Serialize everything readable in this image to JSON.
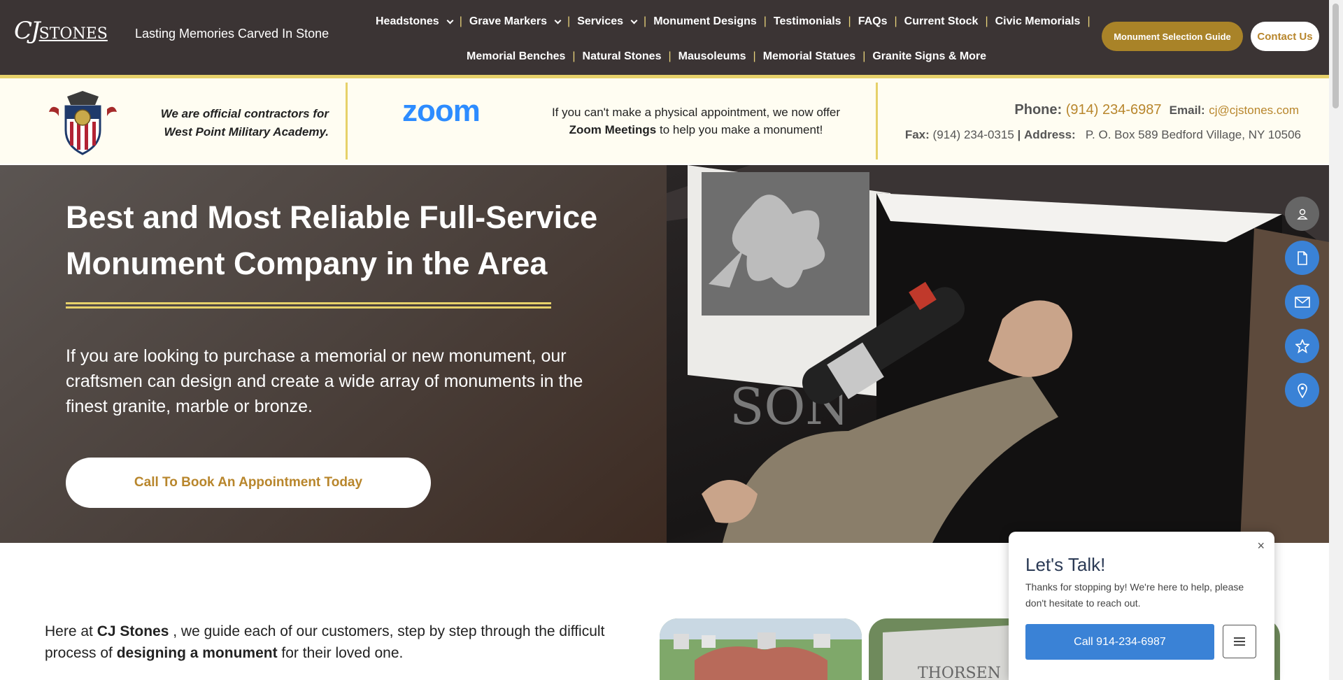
{
  "header": {
    "logo_text_script": "CJ",
    "logo_text_stones": "STONES",
    "tagline": "Lasting Memories Carved In Stone",
    "nav_row1": [
      {
        "label": "Headstones",
        "dropdown": true
      },
      {
        "label": "Grave Markers",
        "dropdown": true
      },
      {
        "label": "Services",
        "dropdown": true
      },
      {
        "label": "Monument Designs",
        "dropdown": false
      },
      {
        "label": "Testimonials",
        "dropdown": false
      },
      {
        "label": "FAQs",
        "dropdown": false
      },
      {
        "label": "Current Stock",
        "dropdown": false
      },
      {
        "label": "Civic Memorials",
        "dropdown": false
      }
    ],
    "nav_row2": [
      {
        "label": "Memorial Benches"
      },
      {
        "label": "Natural Stones"
      },
      {
        "label": "Mausoleums"
      },
      {
        "label": "Memorial Statues"
      },
      {
        "label": "Granite Signs & More"
      }
    ],
    "separator": "|",
    "guide_button": "Monument Selection Guide",
    "contact_button": "Contact Us"
  },
  "info_bar": {
    "contractor_line1": "We are official contractors for",
    "contractor_line2": "West Point Military Academy.",
    "zoom_logo": "zoom",
    "zoom_text_1": "If you can't make a physical appointment, we now offer",
    "zoom_text_bold": "Zoom Meetings",
    "zoom_text_2": "to help you make a monument!",
    "phone_label": "Phone:",
    "phone": "(914) 234-6987",
    "email_label": "Email:",
    "email": "cj@cjstones.com",
    "fax_label": "Fax:",
    "fax": "(914) 234-0315",
    "address_sep": "|",
    "address_label": "Address:",
    "address": "P. O. Box 589 Bedford Village, NY 10506"
  },
  "hero": {
    "title": "Best and Most Reliable Full-Service Monument Company in the Area",
    "text": "If you are looking to purchase a memorial or new monument, our craftsmen can design and create a wide array of monuments in the finest granite, marble or bronze.",
    "button": "Call To Book An Appointment Today"
  },
  "side_buttons": [
    "user-icon",
    "document-icon",
    "mail-icon",
    "star-icon",
    "location-pin-icon"
  ],
  "lower": {
    "text_1": "Here at",
    "brand": "CJ Stones",
    "text_2": ", we guide each of our customers, step by step through the difficult process of",
    "bold_2": "designing a monument",
    "text_3": "for their loved one."
  },
  "chat": {
    "close": "×",
    "title": "Let's Talk!",
    "text": "Thanks for stopping by! We're here to help, please don't hesitate to reach out.",
    "call_button": "Call 914-234-6987"
  },
  "colors": {
    "header_bg": "#3b3434",
    "accent_gold": "#e6d16a",
    "button_gold": "#a98328",
    "text_gold": "#b8862c",
    "zoom_blue": "#2d8cff",
    "chat_blue": "#3a82d6"
  }
}
